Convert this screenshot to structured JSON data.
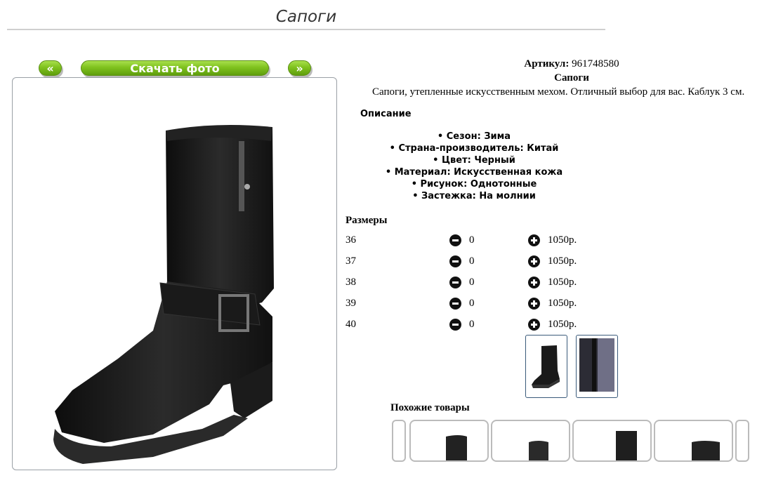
{
  "page": {
    "title": "Сапоги"
  },
  "nav": {
    "prev_label": "«",
    "download_label": "Скачать фото",
    "next_label": "»"
  },
  "product": {
    "sku_label": "Артикул:",
    "sku_value": "961748580",
    "name": "Сапоги",
    "description": "Сапоги, утепленные искусственным мехом. Отличный выбор для вас. Каблук 3 см."
  },
  "details": {
    "heading": "Описание",
    "features": [
      "Сезон: Зима",
      "Страна-производитель: Китай",
      "Цвет: Черный",
      "Материал: Искусственная кожа",
      "Рисунок: Однотонные",
      "Застежка: На молнии"
    ]
  },
  "sizes": {
    "heading": "Размеры",
    "rows": [
      {
        "size": "36",
        "qty": "0",
        "price": "1050р."
      },
      {
        "size": "37",
        "qty": "0",
        "price": "1050р."
      },
      {
        "size": "38",
        "qty": "0",
        "price": "1050р."
      },
      {
        "size": "39",
        "qty": "0",
        "price": "1050р."
      },
      {
        "size": "40",
        "qty": "0",
        "price": "1050р."
      }
    ]
  },
  "similar": {
    "heading": "Похожие товары"
  },
  "colors": {
    "button_green": "#7fc21e",
    "frame_border": "#9aa0a6"
  }
}
